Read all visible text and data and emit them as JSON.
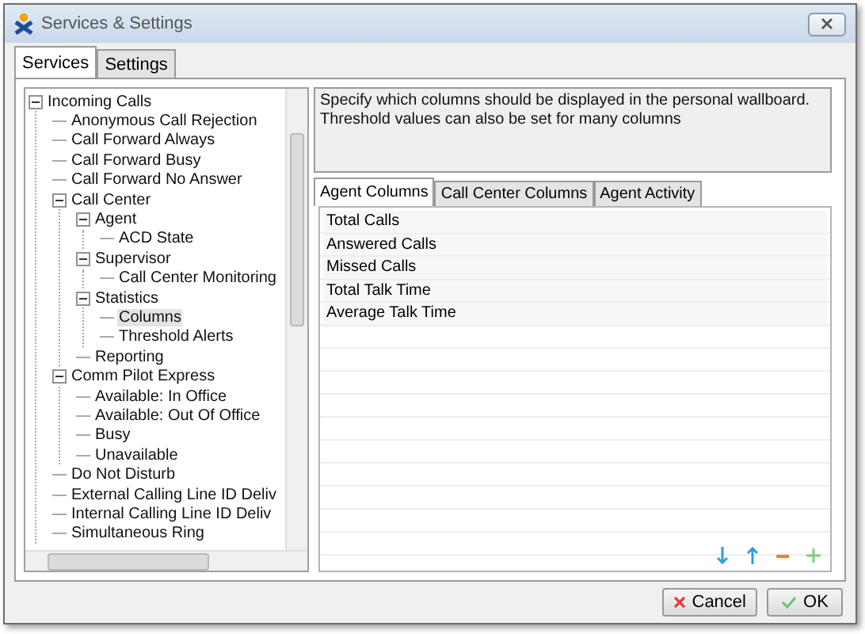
{
  "window": {
    "title": "Services & Settings"
  },
  "tabs": [
    {
      "label": "Services",
      "selected": true
    },
    {
      "label": "Settings",
      "selected": false
    }
  ],
  "tree": [
    {
      "label": "Incoming Calls",
      "expanded": true,
      "selected": false,
      "children": [
        {
          "label": "Anonymous Call Rejection",
          "selected": false
        },
        {
          "label": "Call Forward Always",
          "selected": false
        },
        {
          "label": "Call Forward Busy",
          "selected": false
        },
        {
          "label": "Call Forward No Answer",
          "selected": false
        },
        {
          "label": "Call Center",
          "expanded": true,
          "selected": false,
          "children": [
            {
              "label": "Agent",
              "expanded": true,
              "selected": false,
              "children": [
                {
                  "label": "ACD State",
                  "selected": false
                }
              ]
            },
            {
              "label": "Supervisor",
              "expanded": true,
              "selected": false,
              "children": [
                {
                  "label": "Call Center Monitoring",
                  "selected": false
                }
              ]
            },
            {
              "label": "Statistics",
              "expanded": true,
              "selected": false,
              "children": [
                {
                  "label": "Columns",
                  "selected": true
                },
                {
                  "label": "Threshold Alerts",
                  "selected": false
                }
              ]
            },
            {
              "label": "Reporting",
              "selected": false
            }
          ]
        },
        {
          "label": "Comm Pilot Express",
          "expanded": true,
          "selected": false,
          "children": [
            {
              "label": "Available: In Office",
              "selected": false
            },
            {
              "label": "Available: Out Of Office",
              "selected": false
            },
            {
              "label": "Busy",
              "selected": false
            },
            {
              "label": "Unavailable",
              "selected": false
            }
          ]
        },
        {
          "label": "Do Not Disturb",
          "selected": false
        },
        {
          "label": "External Calling Line ID Deliv",
          "selected": false
        },
        {
          "label": "Internal Calling Line ID Deliv",
          "selected": false
        },
        {
          "label": "Simultaneous Ring",
          "selected": false
        }
      ]
    }
  ],
  "description": "Specify which columns should be displayed in the personal wallboard.  Threshold values can also be set for many columns",
  "column_tabs": [
    {
      "label": "Agent Columns",
      "selected": true
    },
    {
      "label": "Call Center Columns",
      "selected": false
    },
    {
      "label": "Agent Activity",
      "selected": false
    }
  ],
  "columns": [
    "Total Calls",
    "Answered Calls",
    "Missed Calls",
    "Total Talk Time",
    "Average Talk Time"
  ],
  "buttons": [
    {
      "label": "Cancel",
      "kind": "cancel"
    },
    {
      "label": "OK",
      "kind": "ok"
    }
  ]
}
